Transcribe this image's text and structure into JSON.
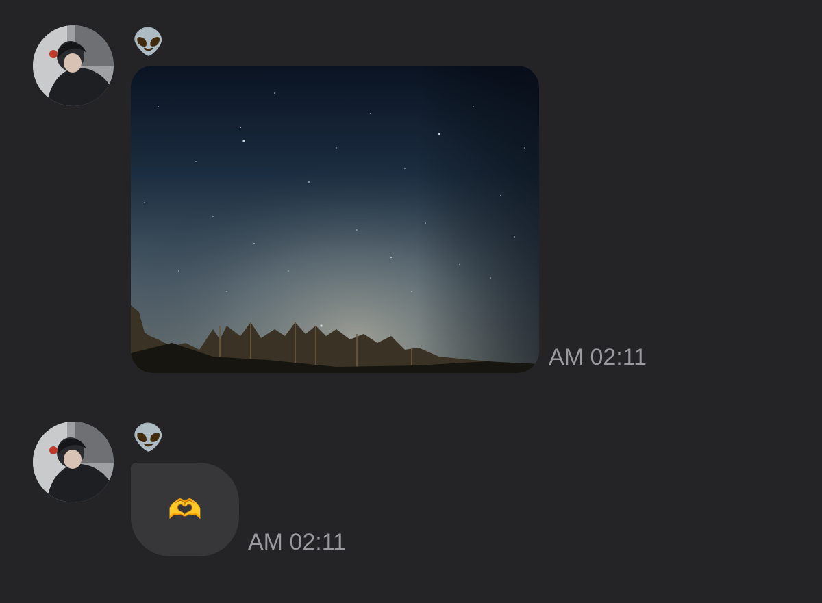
{
  "messages": [
    {
      "sender": {
        "name_emoji": "👽",
        "avatar_alt": "profile photo"
      },
      "type": "image",
      "image_description": "",
      "time": "AM 02:11"
    },
    {
      "sender": {
        "name_emoji": "👽",
        "avatar_alt": "profile photo"
      },
      "type": "emoji",
      "content": "🫶",
      "time": "AM 02:11"
    }
  ],
  "colors": {
    "background": "#242426",
    "bubble": "#37373a",
    "timestamp": "#9a9a9e"
  }
}
